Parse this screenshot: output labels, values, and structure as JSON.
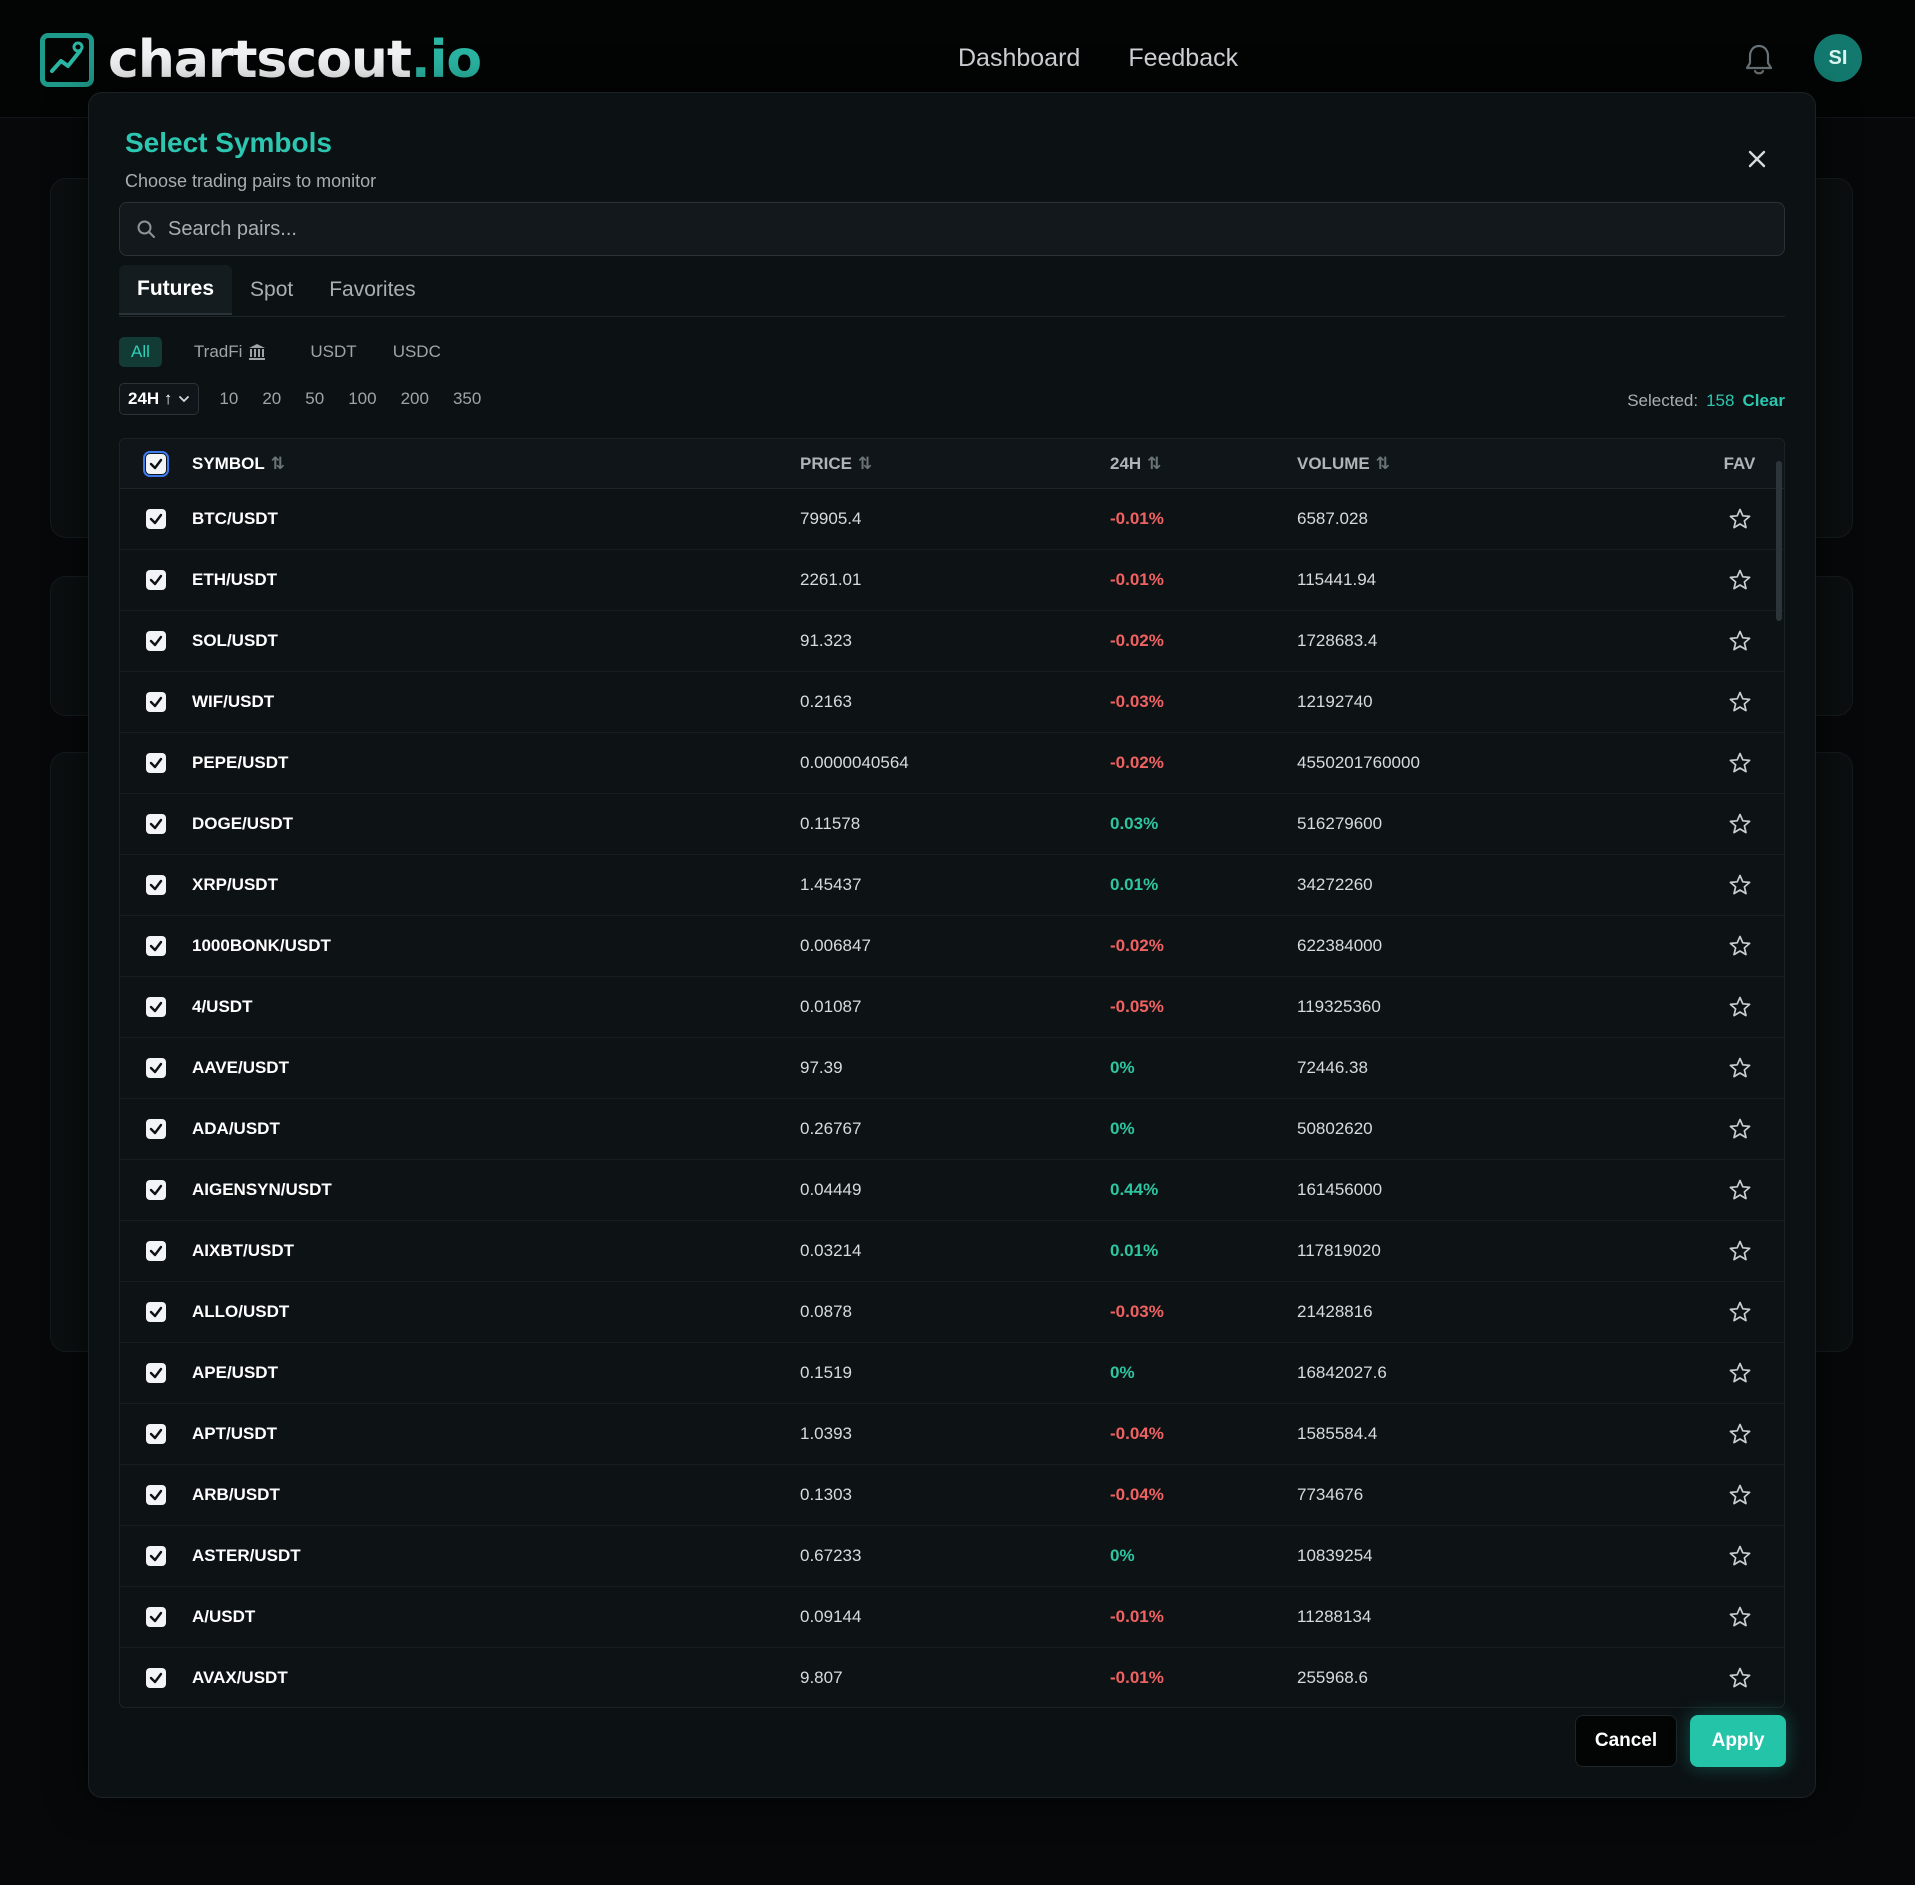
{
  "brand": {
    "name": "chartscout",
    "tld": ".io"
  },
  "nav": {
    "links": [
      "Dashboard",
      "Feedback"
    ],
    "avatar_initials": "SI"
  },
  "modal": {
    "title": "Select Symbols",
    "subtitle": "Choose trading pairs to monitor",
    "search_placeholder": "Search pairs...",
    "tabs": [
      {
        "label": "Futures",
        "active": true
      },
      {
        "label": "Spot",
        "active": false
      },
      {
        "label": "Favorites",
        "active": false
      }
    ],
    "filters": [
      {
        "label": "All",
        "active": true
      },
      {
        "label": "TradFi",
        "active": false,
        "icon": "bank-icon"
      },
      {
        "label": "USDT",
        "active": false
      },
      {
        "label": "USDC",
        "active": false
      }
    ],
    "period": "24H ↑",
    "sizes": [
      "10",
      "20",
      "50",
      "100",
      "200",
      "350"
    ],
    "selected_label": "Selected:",
    "selected_count": "158",
    "clear_label": "Clear",
    "columns": {
      "symbol": "SYMBOL",
      "price": "PRICE",
      "change": "24H",
      "volume": "VOLUME",
      "fav": "FAV"
    },
    "rows": [
      {
        "symbol": "BTC/USDT",
        "price": "79905.4",
        "change": "-0.01%",
        "volume": "6587.028",
        "checked": true
      },
      {
        "symbol": "ETH/USDT",
        "price": "2261.01",
        "change": "-0.01%",
        "volume": "115441.94",
        "checked": true
      },
      {
        "symbol": "SOL/USDT",
        "price": "91.323",
        "change": "-0.02%",
        "volume": "1728683.4",
        "checked": true
      },
      {
        "symbol": "WIF/USDT",
        "price": "0.2163",
        "change": "-0.03%",
        "volume": "12192740",
        "checked": true
      },
      {
        "symbol": "PEPE/USDT",
        "price": "0.0000040564",
        "change": "-0.02%",
        "volume": "4550201760000",
        "checked": true
      },
      {
        "symbol": "DOGE/USDT",
        "price": "0.11578",
        "change": "0.03%",
        "volume": "516279600",
        "checked": true
      },
      {
        "symbol": "XRP/USDT",
        "price": "1.45437",
        "change": "0.01%",
        "volume": "34272260",
        "checked": true
      },
      {
        "symbol": "1000BONK/USDT",
        "price": "0.006847",
        "change": "-0.02%",
        "volume": "622384000",
        "checked": true
      },
      {
        "symbol": "4/USDT",
        "price": "0.01087",
        "change": "-0.05%",
        "volume": "119325360",
        "checked": true
      },
      {
        "symbol": "AAVE/USDT",
        "price": "97.39",
        "change": "0%",
        "volume": "72446.38",
        "checked": true
      },
      {
        "symbol": "ADA/USDT",
        "price": "0.26767",
        "change": "0%",
        "volume": "50802620",
        "checked": true
      },
      {
        "symbol": "AIGENSYN/USDT",
        "price": "0.04449",
        "change": "0.44%",
        "volume": "161456000",
        "checked": true
      },
      {
        "symbol": "AIXBT/USDT",
        "price": "0.03214",
        "change": "0.01%",
        "volume": "117819020",
        "checked": true
      },
      {
        "symbol": "ALLO/USDT",
        "price": "0.0878",
        "change": "-0.03%",
        "volume": "21428816",
        "checked": true
      },
      {
        "symbol": "APE/USDT",
        "price": "0.1519",
        "change": "0%",
        "volume": "16842027.6",
        "checked": true
      },
      {
        "symbol": "APT/USDT",
        "price": "1.0393",
        "change": "-0.04%",
        "volume": "1585584.4",
        "checked": true
      },
      {
        "symbol": "ARB/USDT",
        "price": "0.1303",
        "change": "-0.04%",
        "volume": "7734676",
        "checked": true
      },
      {
        "symbol": "ASTER/USDT",
        "price": "0.67233",
        "change": "0%",
        "volume": "10839254",
        "checked": true
      },
      {
        "symbol": "A/USDT",
        "price": "0.09144",
        "change": "-0.01%",
        "volume": "11288134",
        "checked": true
      },
      {
        "symbol": "AVAX/USDT",
        "price": "9.807",
        "change": "-0.01%",
        "volume": "255968.6",
        "checked": true
      }
    ],
    "cancel_label": "Cancel",
    "apply_label": "Apply"
  },
  "colors": {
    "accent": "#2dc6b0",
    "negative": "#f06262",
    "positive": "#2dc6a0",
    "background": "#060809"
  }
}
